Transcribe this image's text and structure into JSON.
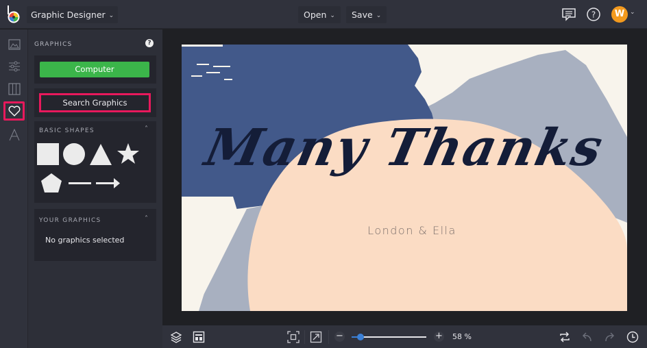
{
  "topbar": {
    "app_switcher_label": "Graphic Designer",
    "open_label": "Open",
    "save_label": "Save",
    "avatar_initial": "W",
    "icons": [
      "logo-icon",
      "chat-icon",
      "help-icon"
    ]
  },
  "rail": {
    "items": [
      {
        "name": "image",
        "icon": "image-icon",
        "active": false
      },
      {
        "name": "adjust",
        "icon": "sliders-icon",
        "active": false
      },
      {
        "name": "frames",
        "icon": "columns-icon",
        "active": false
      },
      {
        "name": "graphics",
        "icon": "heart-icon",
        "active": true
      },
      {
        "name": "text",
        "icon": "text-icon",
        "active": false
      }
    ]
  },
  "panel": {
    "title": "GRAPHICS",
    "help_glyph": "?",
    "computer_button": "Computer",
    "search_button": "Search Graphics",
    "basic_shapes": {
      "title": "BASIC SHAPES",
      "collapse_glyph": "^",
      "shapes": [
        "square",
        "circle",
        "triangle",
        "star",
        "pentagon",
        "line",
        "arrow"
      ]
    },
    "your_graphics": {
      "title": "YOUR GRAPHICS",
      "collapse_glyph": "^",
      "empty_text": "No graphics selected"
    }
  },
  "canvas": {
    "headline": "Many Thanks",
    "subline": "London & Ella",
    "colors": {
      "background": "#f8f4ec",
      "navy_brush": "#42598a",
      "grey_brush": "#a8b0c0",
      "peach_blob": "#fbdcc4",
      "headline": "#141d38",
      "subline": "#7b6f6b"
    }
  },
  "bottombar": {
    "zoom_out_glyph": "−",
    "zoom_in_glyph": "+",
    "zoom_value": "58 %",
    "zoom_fraction": 0.12,
    "icons": [
      "layers-icon",
      "layout-icon",
      "fit-screen-icon",
      "expand-icon",
      "swap-icon",
      "undo-icon",
      "redo-icon",
      "history-icon"
    ]
  },
  "colors": {
    "accent_highlight": "#e8195c",
    "computer_button": "#3bb54a",
    "slider": "#3b80d6",
    "avatar": "#f39a1e"
  }
}
